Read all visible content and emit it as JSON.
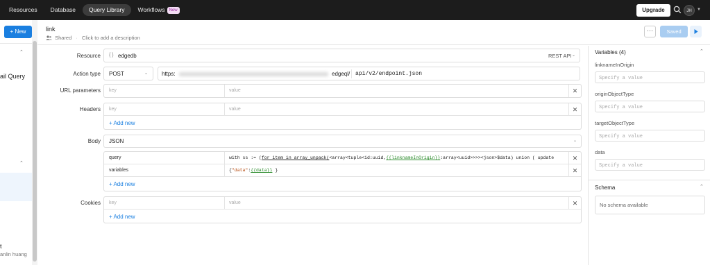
{
  "nav": {
    "items": [
      {
        "label": "Resources",
        "active": false
      },
      {
        "label": "Database",
        "active": false
      },
      {
        "label": "Query Library",
        "active": true
      },
      {
        "label": "Workflows",
        "active": false
      }
    ],
    "workflows_badge": "New",
    "upgrade_label": "Upgrade",
    "avatar_initials": "JH"
  },
  "left_panel": {
    "new_button": "+ New",
    "items": [
      {
        "label": "ail Query"
      },
      {
        "label": "t"
      },
      {
        "sub": "anlin huang"
      }
    ]
  },
  "header": {
    "title": "link",
    "sharing": "Shared",
    "description_placeholder": "Click to add a description",
    "more_label": "···",
    "saved_label": "Saved"
  },
  "form": {
    "resource": {
      "label": "Resource",
      "value": "edgedb",
      "type": "REST API"
    },
    "action": {
      "label": "Action type",
      "method": "POST",
      "url_prefix": "https:",
      "url_suffix": "edgeql/",
      "path_placeholder": "api/v2/endpoint.json"
    },
    "url_params": {
      "label": "URL parameters",
      "rows": [
        {
          "key_placeholder": "key",
          "value_placeholder": "value"
        }
      ]
    },
    "headers": {
      "label": "Headers",
      "rows": [
        {
          "key_placeholder": "key",
          "value_placeholder": "value"
        }
      ],
      "add_new": "+ Add new"
    },
    "body": {
      "label": "Body",
      "format": "JSON",
      "rows": [
        {
          "key": "query",
          "value_pre": "with ss := (",
          "value_for": "for item in array_unpack(",
          "value_mid": "<array<tuple<id:uuid,",
          "value_tpl": "{{linknameInOrigin}}",
          "value_post": ":array<uuid>>>><json>$data) union ( update"
        },
        {
          "key": "variables",
          "value_pre": "{",
          "value_str": "\"data\"",
          "value_colon": ":",
          "value_tpl": "{{data}}",
          "value_post": " }"
        }
      ],
      "add_new": "+ Add new"
    },
    "cookies": {
      "label": "Cookies",
      "rows": [
        {
          "key_placeholder": "key",
          "value_placeholder": "value"
        }
      ],
      "add_new": "+ Add new"
    }
  },
  "right_panel": {
    "variables_title": "Variables (4)",
    "variables": [
      {
        "name": "linknameInOrigin",
        "placeholder": "Specify a value"
      },
      {
        "name": "originObjectType",
        "placeholder": "Specify a value"
      },
      {
        "name": "targetObjectType",
        "placeholder": "Specify a value"
      },
      {
        "name": "data",
        "placeholder": "Specify a value"
      }
    ],
    "schema_title": "Schema",
    "schema_empty": "No schema available"
  },
  "colors": {
    "accent": "#1a7fe0",
    "nav_bg": "#1c1c1c",
    "badge_bg": "#f3dcf4",
    "template_green": "#2a8a2a"
  }
}
